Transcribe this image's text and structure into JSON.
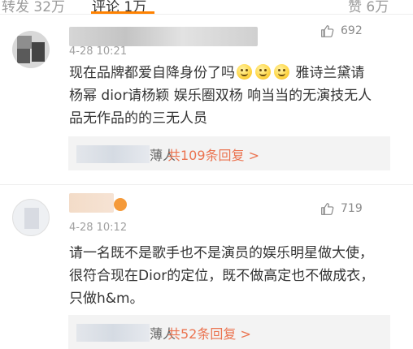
{
  "tabs": [
    {
      "label": "转发 32万"
    },
    {
      "label": "评论 1万"
    },
    {
      "label": "赞 6万"
    }
  ],
  "comments": [
    {
      "time": "4-28 10:21",
      "likes": "692",
      "lines": [
        "现在品牌都爱自降身份了吗",
        "雅诗兰黛请",
        "杨幂 dior请杨颖 娱乐圈双杨 响当当的无演技无人",
        "品无作品的的三无人员"
      ],
      "emoji_count": 3,
      "reply_tail": "薄人",
      "reply_link": "共109条回复 >"
    },
    {
      "time": "4-28 10:12",
      "likes": "719",
      "lines": [
        "请一名既不是歌手也不是演员的娱乐明星做大使，",
        "很符合现在Dior的定位，既不做高定也不做成衣，",
        "只做h&m。"
      ],
      "reply_tail": "薄人",
      "reply_link": "共52条回复 >"
    }
  ],
  "icons": {
    "like": "thumbs-up-icon",
    "badge": "vip-badge-icon"
  },
  "colors": {
    "accent": "#ff8200",
    "link": "#eb7350",
    "text": "#333333",
    "meta": "#a0a0a0"
  }
}
